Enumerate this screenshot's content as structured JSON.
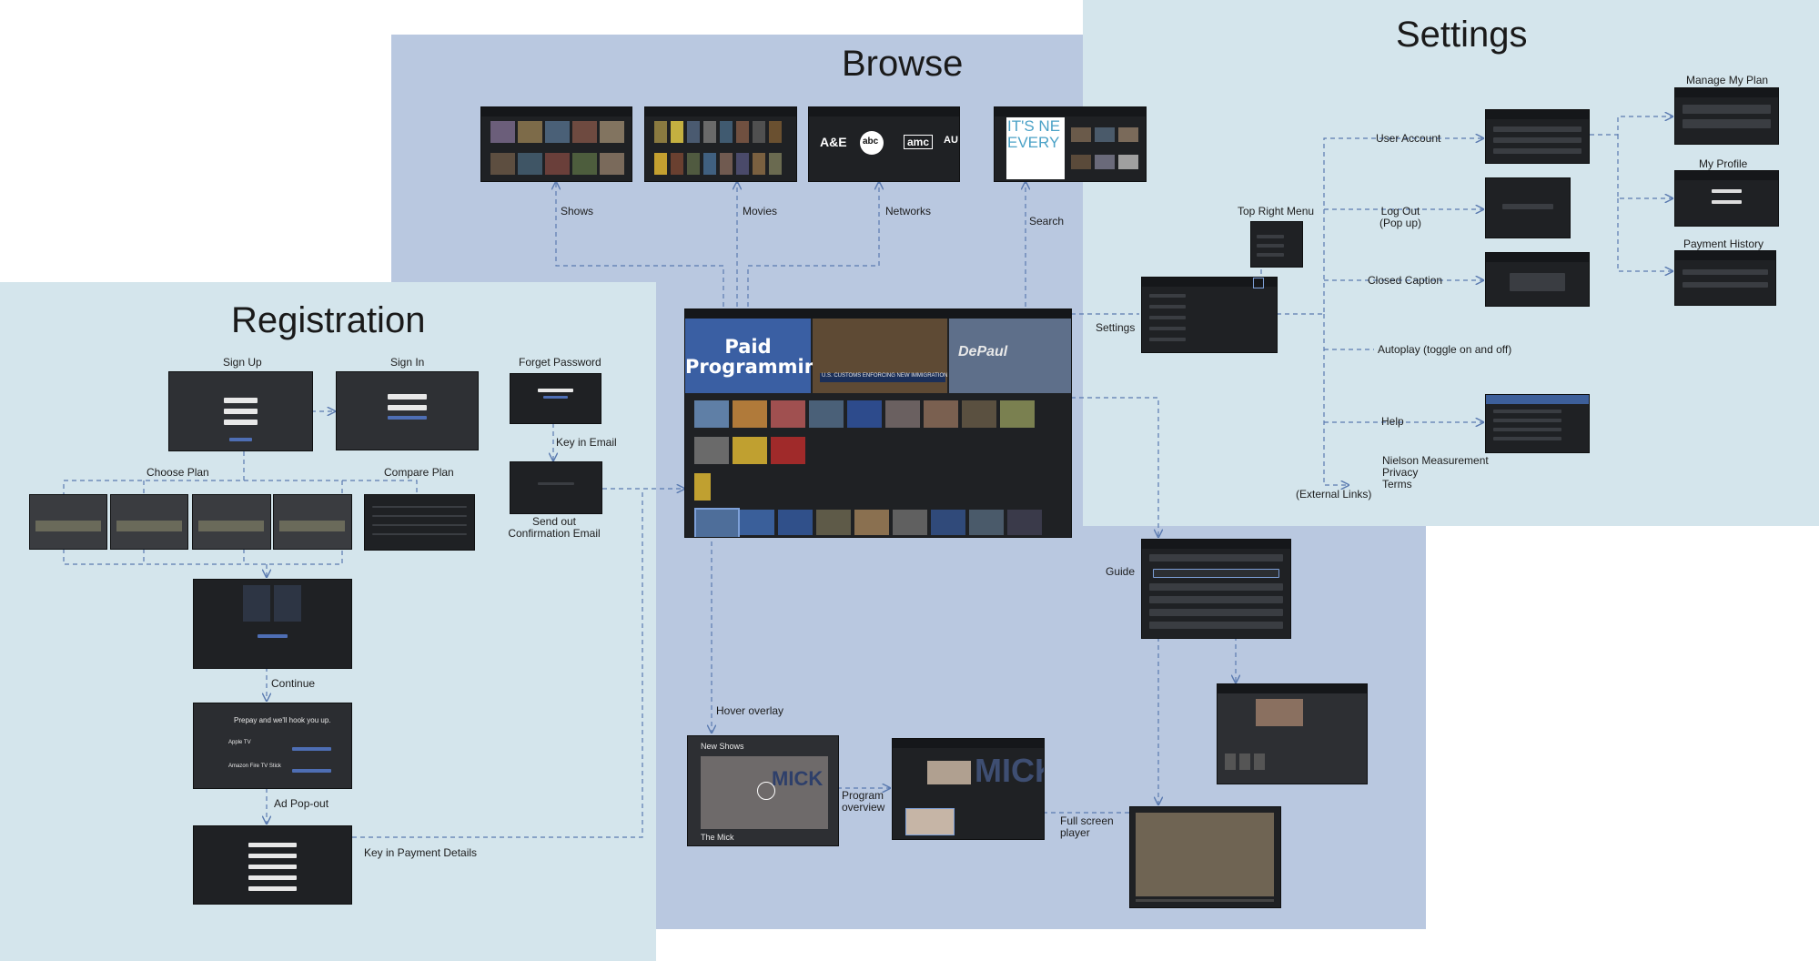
{
  "regions": {
    "browse": "Browse",
    "settings": "Settings",
    "registration": "Registration"
  },
  "colors": {
    "browse_bg": "#b9c8e0",
    "settings_bg": "#d4e5ec",
    "registration_bg": "#d4e5ec",
    "screen_bg": "#1f2124",
    "arrow": "#5a7ab0"
  },
  "browse": {
    "shows": "Shows",
    "movies": "Movies",
    "networks": "Networks",
    "search": "Search",
    "hover_overlay": "Hover overlay",
    "program_overview": "Program\noverview",
    "full_screen_player": "Full screen\nplayer",
    "guide": "Guide",
    "hero_text": "Paid\nProgramming",
    "new_shows": "New Shows",
    "the_mick": "The Mick",
    "mick": "MICK",
    "search_banner": "IT'S NE\nEVERY",
    "networks_logos": [
      "A&E",
      "abc",
      "amc",
      "AU"
    ],
    "depaul": "DePaul",
    "news_ticker": "U.S. CUSTOMS ENFORCING NEW IMMIGRATION BAN"
  },
  "settings": {
    "top_right_menu": "Top Right Menu",
    "settings_label": "Settings",
    "user_account": "User Account",
    "log_out": "Log Out\n(Pop up)",
    "closed_caption": "Closed Caption",
    "autoplay": "Autoplay (toggle on and off)",
    "help": "Help",
    "external": "Nielson Measurement\nPrivacy\nTerms",
    "external_links": "(External Links)",
    "manage_plan": "Manage My Plan",
    "my_profile": "My Profile",
    "payment_history": "Payment History"
  },
  "registration": {
    "sign_up": "Sign Up",
    "sign_in": "Sign In",
    "forget_password": "Forget Password",
    "key_in_email": "Key in Email",
    "send_out": "Send out\nConfirmation Email",
    "choose_plan": "Choose Plan",
    "compare_plan": "Compare Plan",
    "continue": "Continue",
    "ad_popout": "Ad Pop-out",
    "key_in_payment": "Key in Payment Details",
    "prepay": "Prepay and we'll hook you up.",
    "apple_tv": "Apple TV",
    "fire_tv": "Amazon Fire TV Stick"
  }
}
